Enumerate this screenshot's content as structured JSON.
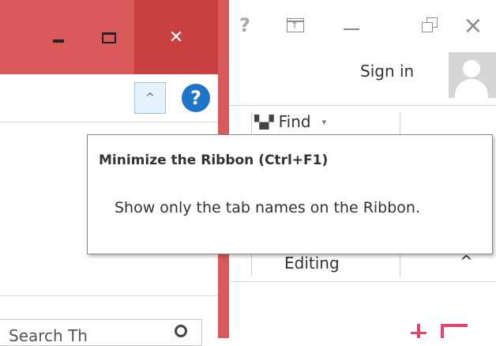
{
  "back_window": {
    "help_glyph": "?",
    "ribbon_display_options_glyph": "↑",
    "sign_in": "Sign in",
    "find_label": "Find",
    "find_caret": "▾",
    "group_label": "Editing",
    "collapse_caret": "^"
  },
  "front_window": {
    "title_bar_color": "#d9595a",
    "close_color": "#c8403f",
    "close_glyph": "✕",
    "collapse_ribbon_glyph": "^",
    "help_glyph": "?",
    "search_text": "Search Th"
  },
  "tooltip": {
    "title": "Minimize the Ribbon (Ctrl+F1)",
    "description": "Show only the tab names on the Ribbon."
  },
  "icons": [
    "help-icon",
    "ribbon-display-options-icon",
    "minimize-icon",
    "restore-icon",
    "close-icon",
    "avatar-icon",
    "binoculars-icon",
    "chevron-up-icon",
    "maximize-icon",
    "search-icon"
  ]
}
